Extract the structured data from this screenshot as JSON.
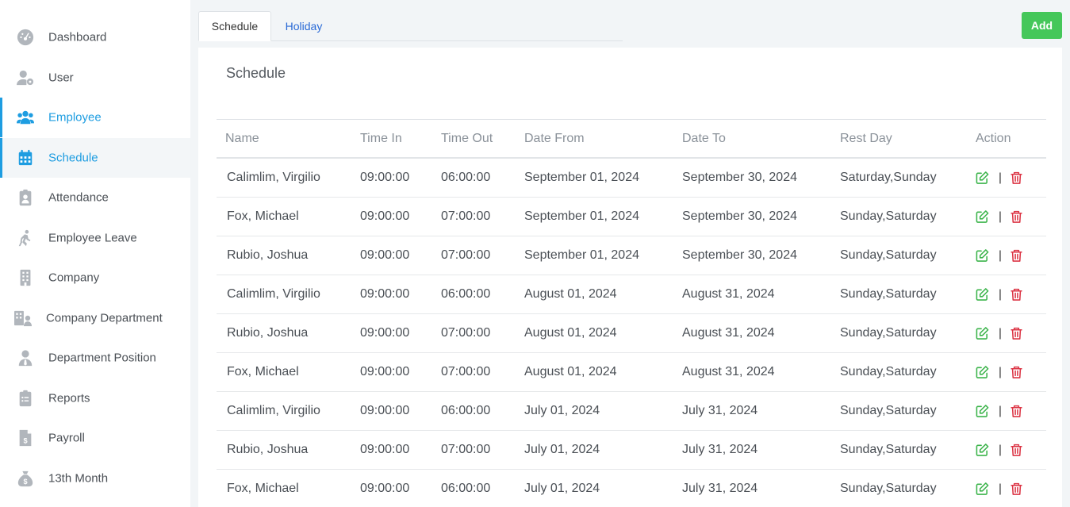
{
  "sidebar": {
    "items": [
      {
        "label": "Dashboard",
        "icon": "dashboard-icon"
      },
      {
        "label": "User",
        "icon": "user-gear-icon"
      },
      {
        "label": "Employee",
        "icon": "users-icon"
      },
      {
        "label": "Schedule",
        "icon": "calendar-icon"
      },
      {
        "label": "Attendance",
        "icon": "clipboard-user-icon"
      },
      {
        "label": "Employee Leave",
        "icon": "person-walking-icon"
      },
      {
        "label": "Company",
        "icon": "building-icon"
      },
      {
        "label": "Company Department",
        "icon": "building-user-icon"
      },
      {
        "label": "Department Position",
        "icon": "user-tie-icon"
      },
      {
        "label": "Reports",
        "icon": "clipboard-list-icon"
      },
      {
        "label": "Payroll",
        "icon": "file-dollar-icon"
      },
      {
        "label": "13th Month",
        "icon": "money-bag-icon"
      }
    ],
    "active": "Schedule",
    "highlighted": "Employee"
  },
  "tabs": [
    {
      "label": "Schedule",
      "active": true
    },
    {
      "label": "Holiday",
      "active": false
    }
  ],
  "toolbar": {
    "add_label": "Add"
  },
  "card": {
    "title": "Schedule"
  },
  "table": {
    "headers": [
      "Name",
      "Time In",
      "Time Out",
      "Date From",
      "Date To",
      "Rest Day",
      "Action"
    ],
    "rows": [
      {
        "name": "Calimlim, Virgilio",
        "time_in": "09:00:00",
        "time_out": "06:00:00",
        "date_from": "September 01, 2024",
        "date_to": "September 30, 2024",
        "rest_day": "Saturday,Sunday"
      },
      {
        "name": "Fox, Michael",
        "time_in": "09:00:00",
        "time_out": "07:00:00",
        "date_from": "September 01, 2024",
        "date_to": "September 30, 2024",
        "rest_day": "Sunday,Saturday"
      },
      {
        "name": "Rubio, Joshua",
        "time_in": "09:00:00",
        "time_out": "07:00:00",
        "date_from": "September 01, 2024",
        "date_to": "September 30, 2024",
        "rest_day": "Sunday,Saturday"
      },
      {
        "name": "Calimlim, Virgilio",
        "time_in": "09:00:00",
        "time_out": "06:00:00",
        "date_from": "August 01, 2024",
        "date_to": "August 31, 2024",
        "rest_day": "Sunday,Saturday"
      },
      {
        "name": "Rubio, Joshua",
        "time_in": "09:00:00",
        "time_out": "07:00:00",
        "date_from": "August 01, 2024",
        "date_to": "August 31, 2024",
        "rest_day": "Sunday,Saturday"
      },
      {
        "name": "Fox, Michael",
        "time_in": "09:00:00",
        "time_out": "07:00:00",
        "date_from": "August 01, 2024",
        "date_to": "August 31, 2024",
        "rest_day": "Sunday,Saturday"
      },
      {
        "name": "Calimlim, Virgilio",
        "time_in": "09:00:00",
        "time_out": "06:00:00",
        "date_from": "July 01, 2024",
        "date_to": "July 31, 2024",
        "rest_day": "Sunday,Saturday"
      },
      {
        "name": "Rubio, Joshua",
        "time_in": "09:00:00",
        "time_out": "07:00:00",
        "date_from": "July 01, 2024",
        "date_to": "July 31, 2024",
        "rest_day": "Sunday,Saturday"
      },
      {
        "name": "Fox, Michael",
        "time_in": "09:00:00",
        "time_out": "06:00:00",
        "date_from": "July 01, 2024",
        "date_to": "July 31, 2024",
        "rest_day": "Sunday,Saturday"
      }
    ],
    "action_separator": "|",
    "actions": {
      "edit_icon": "edit-icon",
      "delete_icon": "trash-icon"
    }
  },
  "colors": {
    "accent": "#1e9de1",
    "add_button": "#45c75a",
    "edit": "#3cb44b",
    "delete": "#dc3545",
    "tab_link": "#2a6ad6"
  }
}
